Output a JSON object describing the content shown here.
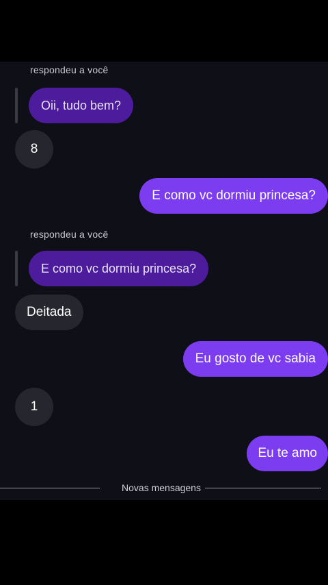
{
  "messages": {
    "reply1_caption": "respondeu a você",
    "reply1_quote": "Oii, tudo bem?",
    "reply1_text": "8",
    "sent1": "E como vc dormiu princesa?",
    "reply2_caption": "respondeu a você",
    "reply2_quote": "E como vc dormiu princesa?",
    "reply2_text": "Deitada",
    "sent2": "Eu gosto de vc sabia",
    "received3": "1",
    "sent3": "Eu te amo"
  },
  "divider": {
    "label": "Novas mensagens"
  },
  "colors": {
    "background": "#0f0f17",
    "sent_bubble": "#7c3cf0",
    "quoted_bubble": "#4d1c9c",
    "received_bubble": "#26262f"
  }
}
